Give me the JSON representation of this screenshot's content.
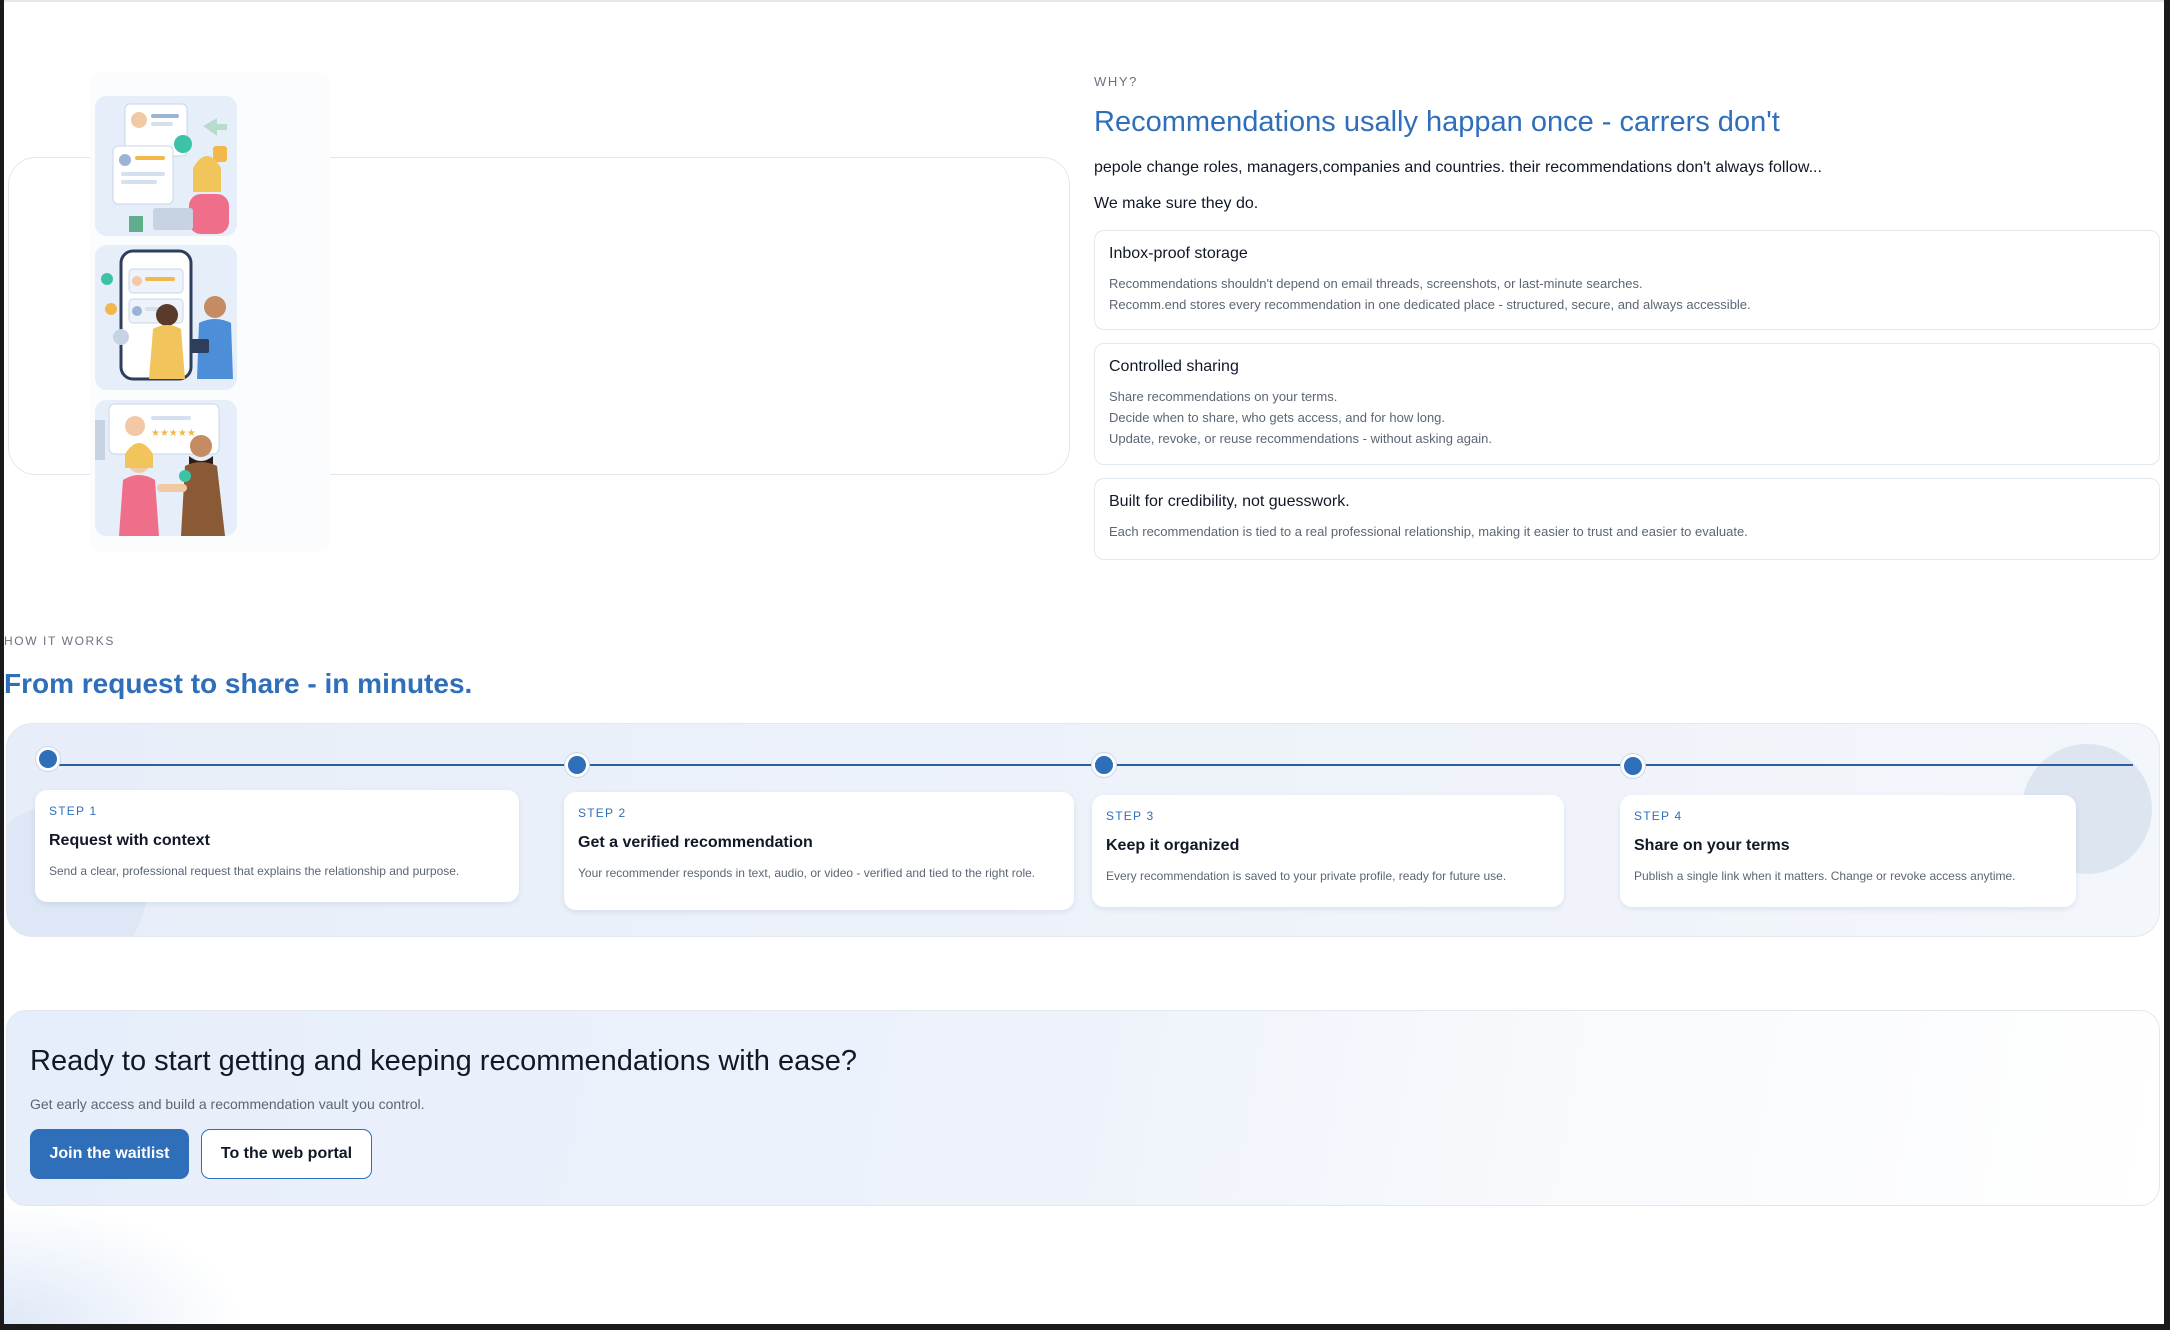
{
  "why": {
    "eyebrow": "WHY?",
    "title": "Recommendations usally happan once - carrers don't",
    "lead": "pepole change roles, managers,companies and countries. their recommendations don't always follow...",
    "lead2": "We make sure they do.",
    "features": [
      {
        "title": "Inbox-proof storage",
        "lines": [
          "Recommendations shouldn't depend on email threads, screenshots, or last-minute searches.",
          "Recomm.end stores every recommendation in one dedicated place - structured, secure, and always accessible."
        ]
      },
      {
        "title": "Controlled sharing",
        "lines": [
          "Share recommendations on your terms.",
          "Decide when to share, who gets access, and for how long.",
          "Update, revoke, or reuse recommendations - without asking again."
        ]
      },
      {
        "title": "Built for credibility, not guesswork.",
        "lines": [
          "Each recommendation is tied to a real professional relationship, making it easier to trust and easier to evaluate."
        ]
      }
    ]
  },
  "how": {
    "eyebrow": "HOW IT WORKS",
    "title": "From request to share - in minutes.",
    "steps": [
      {
        "label": "STEP 1",
        "title": "Request with context",
        "text": "Send a clear, professional request that explains the relationship and purpose."
      },
      {
        "label": "STEP 2",
        "title": "Get a verified recommendation",
        "text": "Your recommender responds in text, audio, or video - verified and tied to the right role."
      },
      {
        "label": "STEP 3",
        "title": "Keep it organized",
        "text": "Every recommendation is saved to your private profile, ready for future use."
      },
      {
        "label": "STEP 4",
        "title": "Share on your terms",
        "text": "Publish a single link when it matters. Change or revoke access anytime."
      }
    ]
  },
  "cta": {
    "title": "Ready to start getting and keeping recommendations with ease?",
    "subtitle": "Get early access and build a recommendation vault you control.",
    "primary_label": "Join the waitlist",
    "secondary_label": "To the web portal"
  },
  "colors": {
    "accent": "#2f6fba",
    "text": "#111827",
    "muted": "#5b6675",
    "border": "#e3e8ef"
  }
}
